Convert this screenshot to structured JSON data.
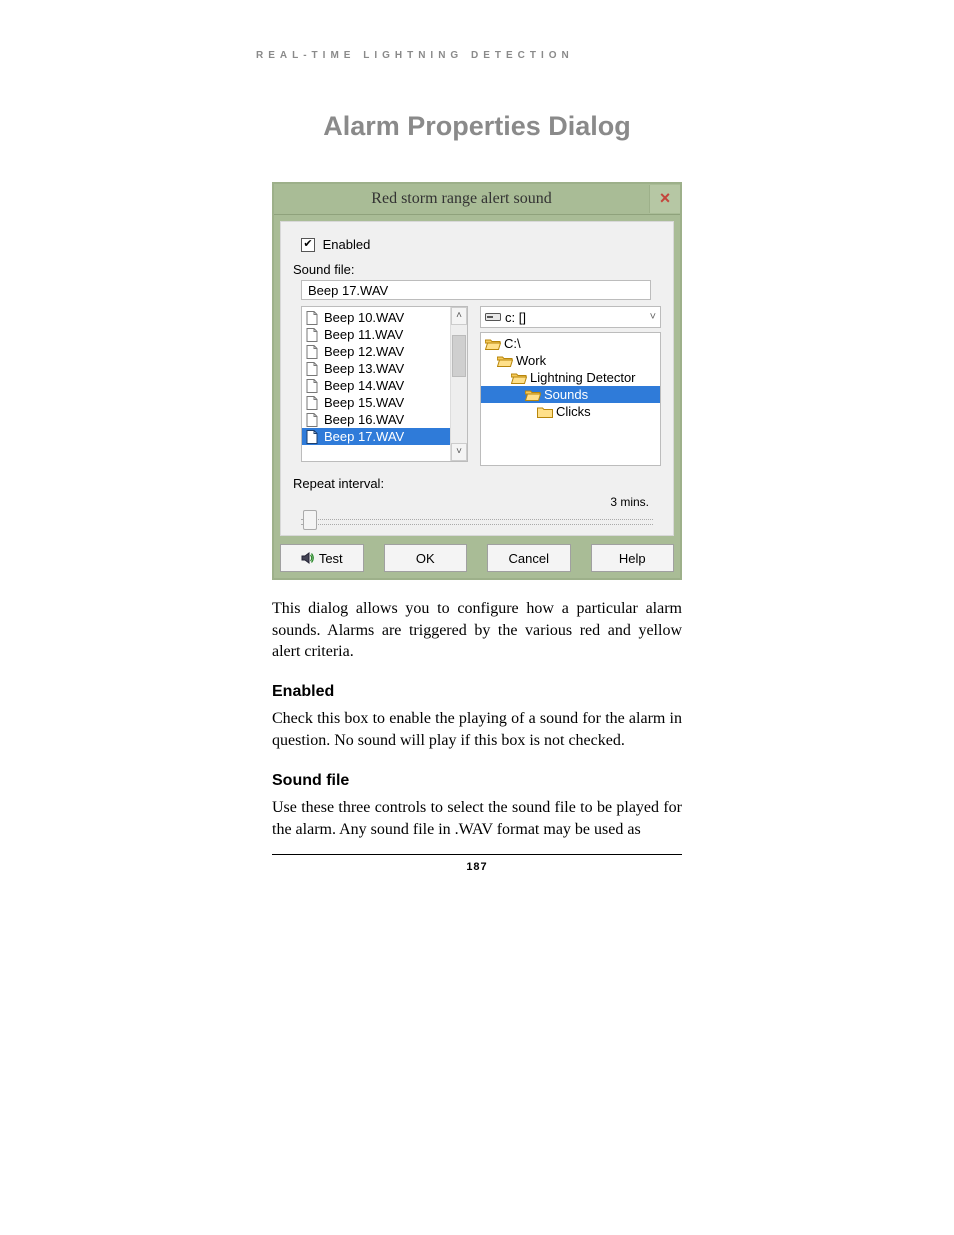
{
  "header": "REAL-TIME LIGHTNING DETECTION",
  "page_title": "Alarm Properties Dialog",
  "dialog": {
    "title": "Red storm range alert sound",
    "enabled_label": "Enabled",
    "enabled_checked": true,
    "sound_file_label": "Sound file:",
    "sound_file_value": "Beep 17.WAV",
    "files": [
      {
        "name": "Beep 10.WAV",
        "selected": false
      },
      {
        "name": "Beep 11.WAV",
        "selected": false
      },
      {
        "name": "Beep 12.WAV",
        "selected": false
      },
      {
        "name": "Beep 13.WAV",
        "selected": false
      },
      {
        "name": "Beep 14.WAV",
        "selected": false
      },
      {
        "name": "Beep 15.WAV",
        "selected": false
      },
      {
        "name": "Beep 16.WAV",
        "selected": false
      },
      {
        "name": "Beep 17.WAV",
        "selected": true
      }
    ],
    "drive_label": "c: []",
    "tree": [
      {
        "name": "C:\\",
        "indent": 0,
        "type": "open",
        "selected": false
      },
      {
        "name": "Work",
        "indent": 1,
        "type": "open",
        "selected": false
      },
      {
        "name": "Lightning Detector",
        "indent": 2,
        "type": "open",
        "selected": false
      },
      {
        "name": "Sounds",
        "indent": 3,
        "type": "open",
        "selected": true
      },
      {
        "name": "Clicks",
        "indent": 4,
        "type": "closed",
        "selected": false
      }
    ],
    "repeat_label": "Repeat interval:",
    "repeat_value": "3 mins.",
    "buttons": {
      "test": "Test",
      "ok": "OK",
      "cancel": "Cancel",
      "help": "Help"
    }
  },
  "text": {
    "intro": "This dialog allows you to configure how a particular alarm sounds.  Alarms are triggered by the various red and yellow alert criteria.",
    "h_enabled": "Enabled",
    "p_enabled": "Check this box to enable the playing of a sound for the alarm in question.  No sound will play if this box is not checked.",
    "h_soundfile": "Sound file",
    "p_soundfile": "Use these three controls to select the sound file to be played for the alarm.  Any sound file in .WAV format may be used as"
  },
  "page_number": "187"
}
